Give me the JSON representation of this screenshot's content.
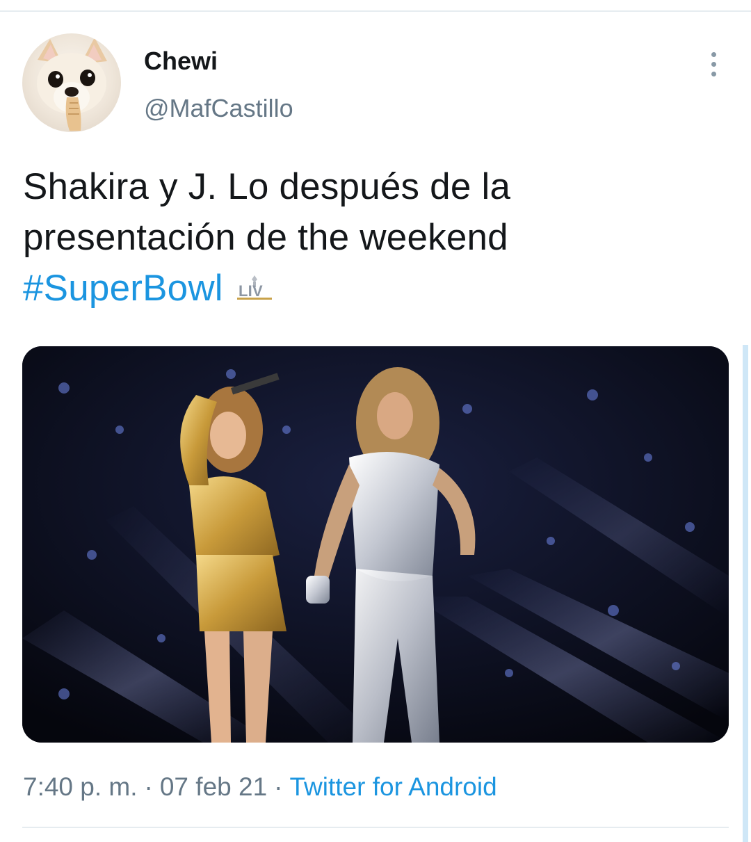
{
  "tweet": {
    "display_name": "Chewi",
    "handle": "@MafCastillo",
    "text_lines": [
      "Shakira y J. Lo después de la",
      "presentación de the weekend"
    ],
    "hashtag": "#SuperBowl",
    "hashflag_text": "LIV",
    "time": "7:40 p. m.",
    "date": "07 feb 21",
    "separator": "·",
    "source": "Twitter for Android"
  },
  "colors": {
    "link": "#1b95e0",
    "secondary_text": "#657786",
    "primary_text": "#14171a",
    "divider": "#e6ecf0"
  },
  "icons": {
    "more": "more-vertical-icon",
    "hashflag": "super-bowl-liv-icon"
  }
}
